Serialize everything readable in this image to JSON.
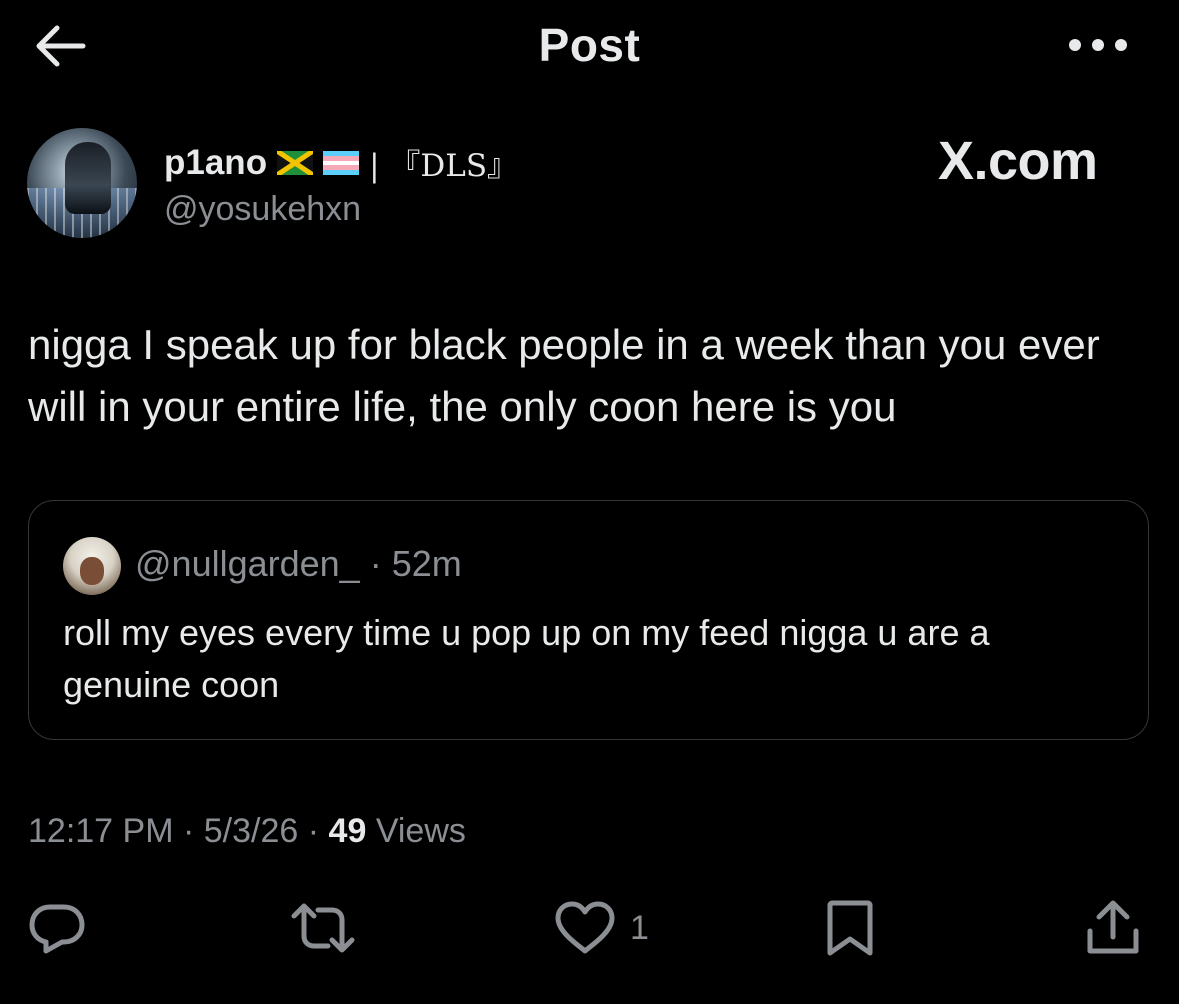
{
  "header": {
    "title": "Post",
    "back_icon": "arrow-left-icon",
    "more_icon": "more-horizontal-icon"
  },
  "author": {
    "name": "p1ano",
    "flags": [
      "jamaica-flag",
      "transgender-flag"
    ],
    "name_suffix": "| 『DLS』",
    "handle": "@yosukehxn"
  },
  "watermark": "X.com",
  "post": {
    "text": "nigga I speak up for black people in a week than you ever will in your entire life, the only coon here is you"
  },
  "quote": {
    "handle": "@nullgarden_",
    "separator": "·",
    "time": "52m",
    "text": "roll my eyes every time u pop up on my feed nigga u are a genuine coon"
  },
  "meta": {
    "time": "12:17 PM",
    "date": "5/3/26",
    "separator": "·",
    "views_count": "49",
    "views_label": "Views"
  },
  "actions": {
    "reply": {
      "icon": "reply-icon",
      "count": ""
    },
    "repost": {
      "icon": "repost-icon",
      "count": ""
    },
    "like": {
      "icon": "heart-icon",
      "count": "1"
    },
    "bookmark": {
      "icon": "bookmark-icon",
      "count": ""
    },
    "share": {
      "icon": "share-icon",
      "count": ""
    }
  },
  "colors": {
    "background": "#000000",
    "text_primary": "#e7e9ea",
    "text_secondary": "#8b8f94",
    "border": "#343638"
  }
}
